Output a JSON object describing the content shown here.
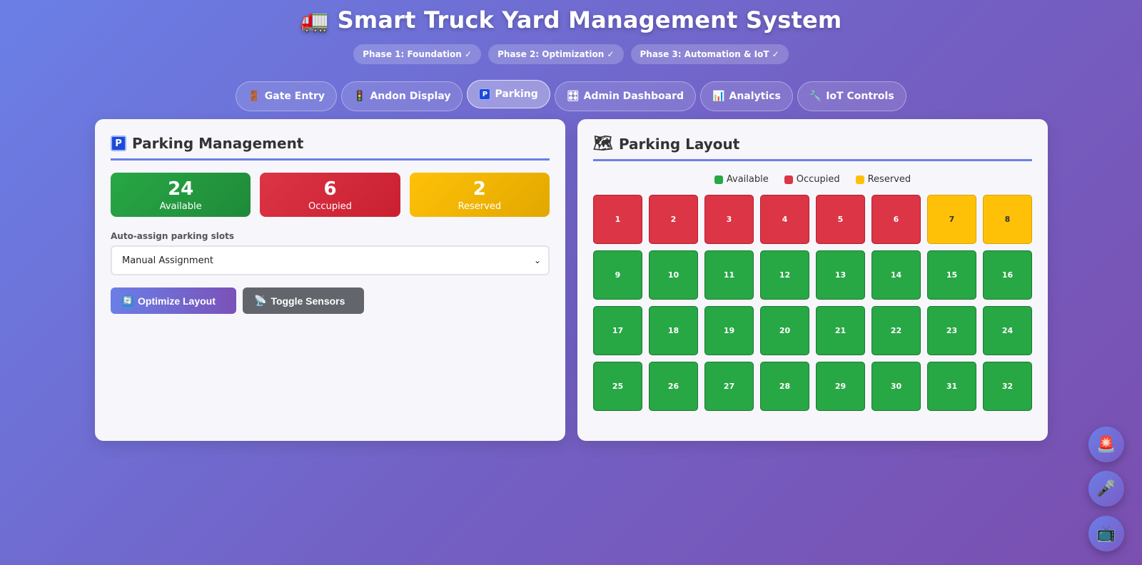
{
  "header": {
    "icon": "truck-icon",
    "title": "Smart Truck Yard Management System",
    "phases": [
      "Phase 1: Foundation ✓",
      "Phase 2: Optimization ✓",
      "Phase 3: Automation & IoT ✓"
    ]
  },
  "tabs": [
    {
      "label": "Gate Entry",
      "icon": "door-icon",
      "glyph": "🚪"
    },
    {
      "label": "Andon Display",
      "icon": "traffic-light-icon",
      "glyph": "🚦"
    },
    {
      "label": "Parking",
      "icon": "parking-icon",
      "glyph": "P",
      "active": true
    },
    {
      "label": "Admin Dashboard",
      "icon": "control-knobs-icon",
      "glyph": "🎛"
    },
    {
      "label": "Analytics",
      "icon": "bar-chart-icon",
      "glyph": "📊"
    },
    {
      "label": "IoT Controls",
      "icon": "wrench-icon",
      "glyph": "🔧"
    }
  ],
  "parking_management": {
    "title": "Parking Management",
    "stats": {
      "available": {
        "value": "24",
        "label": "Available"
      },
      "occupied": {
        "value": "6",
        "label": "Occupied"
      },
      "reserved": {
        "value": "2",
        "label": "Reserved"
      }
    },
    "auto_assign_label": "Auto-assign parking slots",
    "auto_assign_value": "Manual Assignment",
    "optimize_label": "Optimize Layout",
    "toggle_label": "Toggle Sensors"
  },
  "parking_layout": {
    "title": "Parking Layout",
    "legend": {
      "available": "Available",
      "occupied": "Occupied",
      "reserved": "Reserved"
    },
    "colors": {
      "available": "#28a745",
      "occupied": "#dc3545",
      "reserved": "#ffc107"
    },
    "slots": [
      {
        "id": "1",
        "status": "occupied"
      },
      {
        "id": "2",
        "status": "occupied"
      },
      {
        "id": "3",
        "status": "occupied"
      },
      {
        "id": "4",
        "status": "occupied"
      },
      {
        "id": "5",
        "status": "occupied"
      },
      {
        "id": "6",
        "status": "occupied"
      },
      {
        "id": "7",
        "status": "reserved"
      },
      {
        "id": "8",
        "status": "reserved"
      },
      {
        "id": "9",
        "status": "available"
      },
      {
        "id": "10",
        "status": "available"
      },
      {
        "id": "11",
        "status": "available"
      },
      {
        "id": "12",
        "status": "available"
      },
      {
        "id": "13",
        "status": "available"
      },
      {
        "id": "14",
        "status": "available"
      },
      {
        "id": "15",
        "status": "available"
      },
      {
        "id": "16",
        "status": "available"
      },
      {
        "id": "17",
        "status": "available"
      },
      {
        "id": "18",
        "status": "available"
      },
      {
        "id": "19",
        "status": "available"
      },
      {
        "id": "20",
        "status": "available"
      },
      {
        "id": "21",
        "status": "available"
      },
      {
        "id": "22",
        "status": "available"
      },
      {
        "id": "23",
        "status": "available"
      },
      {
        "id": "24",
        "status": "available"
      },
      {
        "id": "25",
        "status": "available"
      },
      {
        "id": "26",
        "status": "available"
      },
      {
        "id": "27",
        "status": "available"
      },
      {
        "id": "28",
        "status": "available"
      },
      {
        "id": "29",
        "status": "available"
      },
      {
        "id": "30",
        "status": "available"
      },
      {
        "id": "31",
        "status": "available"
      },
      {
        "id": "32",
        "status": "available"
      }
    ]
  },
  "fabs": [
    {
      "icon": "siren-icon",
      "glyph": "🚨"
    },
    {
      "icon": "microphone-icon",
      "glyph": "🎤"
    },
    {
      "icon": "tv-icon",
      "glyph": "📺"
    }
  ]
}
